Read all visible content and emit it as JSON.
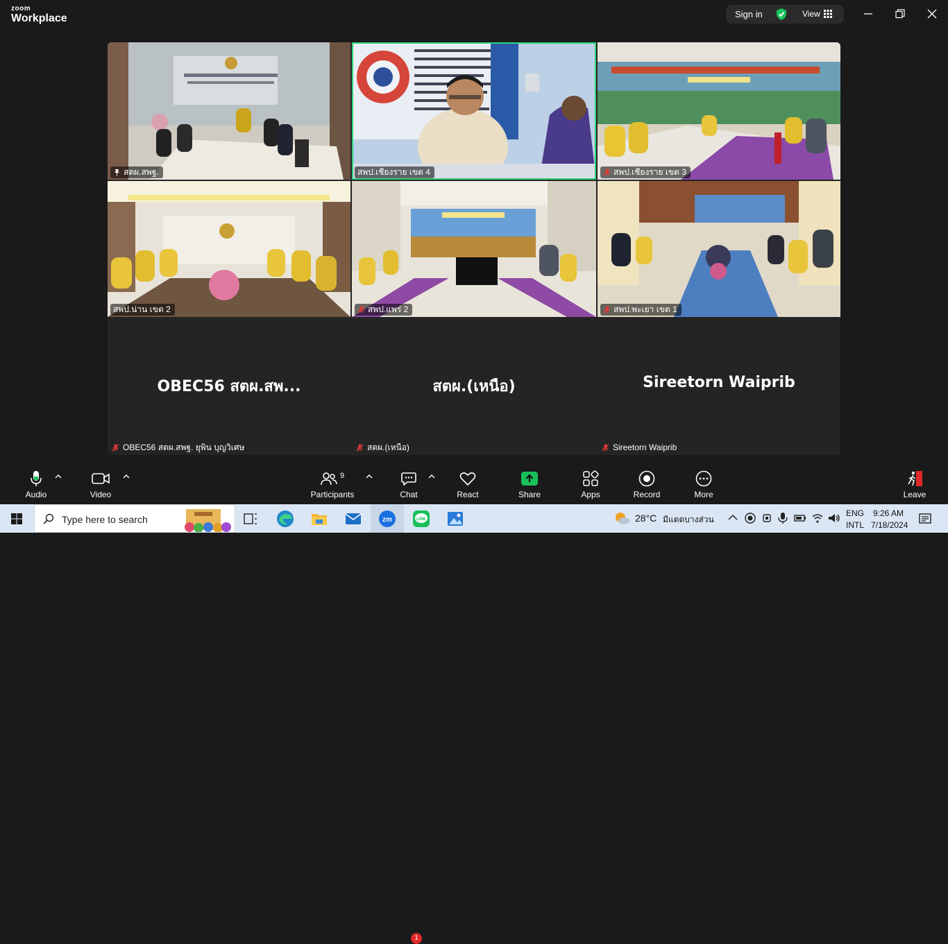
{
  "app": {
    "brand_small": "zoom",
    "brand_large": "Workplace"
  },
  "titlebar": {
    "sign_in": "Sign in",
    "view": "View"
  },
  "tiles": [
    {
      "name": "สตผ.สพฐ.",
      "active": false,
      "pinned": true
    },
    {
      "name": "สพป.เชียงราย เขต 4",
      "active": true,
      "pinned": false
    },
    {
      "name": "สพป.เชียงราย เขต 3",
      "active": false,
      "pinned": false
    },
    {
      "name": "สพป.น่าน เขต 2",
      "active": false,
      "pinned": false
    },
    {
      "name": "สพป.แพร่ 2",
      "active": false,
      "pinned": false
    },
    {
      "name": "สพป.พะเยา เขต 1",
      "active": false,
      "pinned": false
    }
  ],
  "camera_off": [
    {
      "display": "OBEC56 สตผ.สพ...",
      "tag": "OBEC56 สตผ.สพฐ. ยุพิน บุญวิเศษ"
    },
    {
      "display": "สตผ.(เหนือ)",
      "tag": "สตผ.(เหนือ)"
    },
    {
      "display": "Sireetorn Waiprib",
      "tag": "Sireetorn Waiprib"
    }
  ],
  "toolbar": {
    "audio": "Audio",
    "video": "Video",
    "participants": "Participants",
    "participants_count": "9",
    "chat": "Chat",
    "chat_badge": "1",
    "react": "React",
    "share": "Share",
    "apps": "Apps",
    "record": "Record",
    "more": "More",
    "leave": "Leave"
  },
  "taskbar": {
    "search_placeholder": "Type here to search",
    "weather_temp": "28°C",
    "weather_desc": "มีแดดบางส่วน",
    "lang_top": "ENG",
    "lang_bottom": "INTL",
    "time": "9:26 AM",
    "date": "7/18/2024"
  },
  "colors": {
    "active_speaker": "#2fd37a",
    "share_green": "#19c05a",
    "badge_red": "#e02828",
    "muted_red": "#e03a3a"
  }
}
